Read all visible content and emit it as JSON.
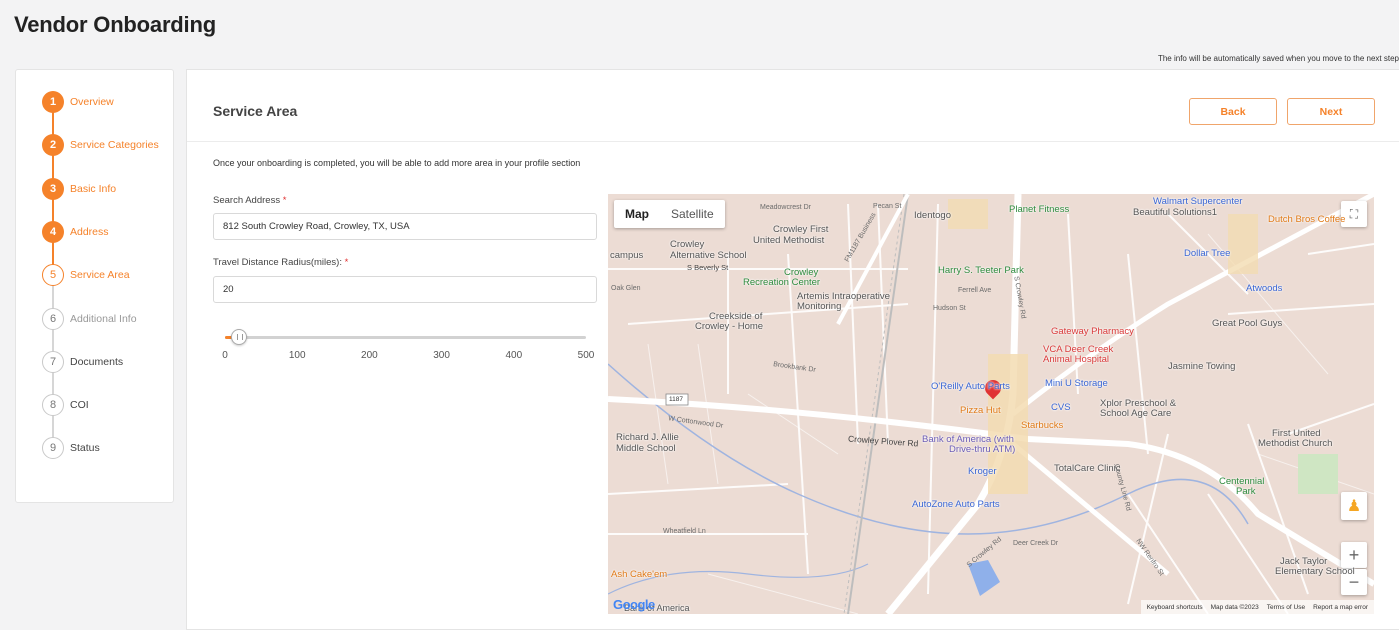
{
  "page": {
    "title": "Vendor Onboarding",
    "autosave_note": "The info will be automatically saved when you move to the next step"
  },
  "steps": [
    {
      "number": "1",
      "label": "Overview",
      "state": "done"
    },
    {
      "number": "2",
      "label": "Service Categories",
      "state": "done"
    },
    {
      "number": "3",
      "label": "Basic Info",
      "state": "done"
    },
    {
      "number": "4",
      "label": "Address",
      "state": "done"
    },
    {
      "number": "5",
      "label": "Service Area",
      "state": "current"
    },
    {
      "number": "6",
      "label": "Additional Info",
      "state": "pending"
    },
    {
      "number": "7",
      "label": "Documents",
      "state": "pending"
    },
    {
      "number": "8",
      "label": "COI",
      "state": "pending"
    },
    {
      "number": "9",
      "label": "Status",
      "state": "pending"
    }
  ],
  "section": {
    "title": "Service Area",
    "back_label": "Back",
    "next_label": "Next",
    "info_text": "Once your onboarding is completed, you will be able to add more area in your profile section"
  },
  "form": {
    "search_label": "Search Address",
    "search_value": "812 South Crowley Road, Crowley, TX, USA",
    "radius_label": "Travel Distance Radius(miles):",
    "required_mark": "*",
    "radius_value": "20",
    "slider_value": 20,
    "slider_max": 500,
    "slider_ticks": [
      "0",
      "100",
      "200",
      "300",
      "400",
      "500"
    ]
  },
  "map": {
    "type_map": "Map",
    "type_satellite": "Satellite",
    "zoom_in": "+",
    "zoom_out": "−",
    "google": "Google",
    "footer": {
      "shortcuts": "Keyboard shortcuts",
      "data": "Map data ©2023",
      "terms": "Terms of Use",
      "report": "Report a map error"
    },
    "pois": {
      "planet_fitness": "Planet Fitness",
      "walmart": "Walmart Supercenter",
      "beautiful": "Beautiful Solutions1",
      "dutch_bros": "Dutch Bros Coffee",
      "crowley_first": "Crowley First",
      "united_methodist": "United Methodist",
      "crowley_alt": "Crowley",
      "alt_school": "Alternative School",
      "campus": "campus",
      "identogo": "Identogo",
      "harry": "Harry S. Teeter Park",
      "dollar_tree": "Dollar Tree",
      "crowley_rec": "Crowley",
      "rec_center": "Recreation Center",
      "artemis": "Artemis Intraoperative",
      "monitoring": "Monitoring",
      "atwoods": "Atwoods",
      "creekside": "Creekside of",
      "crowley_home": "Crowley - Home",
      "great_pool": "Great Pool Guys",
      "gateway": "Gateway Pharmacy",
      "vca": "VCA Deer Creek",
      "animal_hospital": "Animal Hospital",
      "jasmine": "Jasmine Towing",
      "oreilly": "O'Reilly Auto Parts",
      "mini_u": "Mini U Storage",
      "pizza_hut": "Pizza Hut",
      "cvs": "CVS",
      "xplor": "Xplor Preschool &",
      "school_age": "School Age Care",
      "starbucks": "Starbucks",
      "first_united": "First United",
      "methodist_church": "Methodist Church",
      "richard": "Richard J. Allie",
      "middle_school": "Middle School",
      "bank": "Bank of America (with",
      "drive_thru": "Drive-thru ATM)",
      "kroger": "Kroger",
      "totalcare": "TotalCare Clinic",
      "centennial": "Centennial",
      "park": "Park",
      "autozone": "AutoZone Auto Parts",
      "jack_taylor": "Jack Taylor",
      "elementary": "Elementary School",
      "ash_cake": "Ash Cake'em",
      "boa_bottom": "Bank of America"
    },
    "streets": {
      "beverly": "S Beverly St",
      "crowley_plover": "Crowley Plover Rd",
      "crowley_rd": "S Crowley Rd",
      "crowley_rd2": "S Crowley Rd",
      "fm1187": "FM1187 Business",
      "renfro": "NW Renfro St",
      "route": "1187",
      "meadowcrest": "Meadowcrest Dr",
      "pecan": "Pecan St",
      "wheatfield": "Wheatfield Ln",
      "deer_creek": "Deer Creek Dr",
      "cottonwood": "W Cottonwood Dr",
      "brookbank": "Brookbank Dr",
      "county_line": "County Line Rd",
      "hudson": "Hudson St",
      "ferrell": "Ferrell Ave",
      "glen": "Oak Glen"
    }
  }
}
